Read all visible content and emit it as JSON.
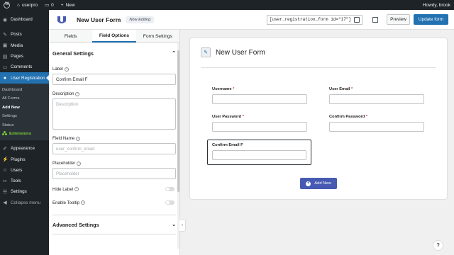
{
  "adminbar": {
    "site_name": "userpro",
    "comments_count": "0",
    "new_label": "New",
    "greeting": "Howdy, brook"
  },
  "wp_menu": {
    "items_top": [
      {
        "label": "Dashboard",
        "icon": "dashboard-icon"
      },
      {
        "label": "Posts",
        "icon": "pin-icon"
      },
      {
        "label": "Media",
        "icon": "media-icon"
      },
      {
        "label": "Pages",
        "icon": "page-icon"
      },
      {
        "label": "Comments",
        "icon": "comment-icon"
      },
      {
        "label": "User Registration",
        "icon": "ur-icon"
      }
    ],
    "submenu": [
      "Dashboard",
      "All Forms",
      "Add New",
      "Settings",
      "Status",
      "Extensions"
    ],
    "items_bottom": [
      {
        "label": "Appearance",
        "icon": "brush-icon"
      },
      {
        "label": "Plugins",
        "icon": "plugin-icon"
      },
      {
        "label": "Users",
        "icon": "users-icon"
      },
      {
        "label": "Tools",
        "icon": "wrench-icon"
      },
      {
        "label": "Settings",
        "icon": "settings-icon"
      },
      {
        "label": "Collapse menu",
        "icon": "collapse-icon"
      }
    ]
  },
  "header": {
    "form_title": "New User Form",
    "badge": "Now Editing",
    "shortcode": "[user_registration_form id=\"17\"]",
    "preview_label": "Preview",
    "update_label": "Update form"
  },
  "panel": {
    "tabs": [
      "Fields",
      "Field Options",
      "Form Settings"
    ],
    "general_title": "General Settings",
    "label_label": "Label",
    "label_value": "Confirm Email F",
    "description_label": "Description",
    "description_placeholder": "Description",
    "field_name_label": "Field Name",
    "field_name_value": "user_confirm_email",
    "placeholder_label": "Placeholder",
    "placeholder_placeholder": "Placeholder",
    "hide_label": "Hide Label",
    "enable_tooltip": "Enable Tooltip",
    "advanced_title": "Advanced Settings"
  },
  "canvas": {
    "title": "New User Form",
    "fields": [
      {
        "label": "Username",
        "required": true
      },
      {
        "label": "User Email",
        "required": true
      },
      {
        "label": "User Password",
        "required": true
      },
      {
        "label": "Confirm Password",
        "required": true
      }
    ],
    "selected_field_label": "Confirm Email F",
    "add_new_label": "Add New"
  },
  "colors": {
    "wp_dark": "#1d2327",
    "wp_blue": "#2271b1",
    "add_button": "#475bb2",
    "required": "#d63638",
    "extensions_green": "#7ad03a"
  }
}
